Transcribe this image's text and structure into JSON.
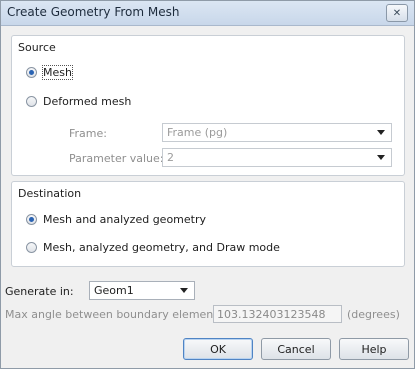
{
  "window": {
    "title": "Create Geometry From Mesh",
    "close_glyph": "✕"
  },
  "source": {
    "label": "Source",
    "options": [
      {
        "label": "Mesh",
        "checked": true
      },
      {
        "label": "Deformed mesh",
        "checked": false
      }
    ],
    "frame": {
      "label": "Frame:",
      "value": "Frame (pg)"
    },
    "parameter": {
      "label": "Parameter value:",
      "value": "2"
    }
  },
  "destination": {
    "label": "Destination",
    "options": [
      {
        "label": "Mesh and analyzed geometry",
        "checked": true
      },
      {
        "label": "Mesh, analyzed geometry, and Draw mode",
        "checked": false
      }
    ]
  },
  "generate_in": {
    "label": "Generate in:",
    "value": "Geom1"
  },
  "max_angle": {
    "label": "Max angle between boundary elements:",
    "value": "103.132403123548",
    "unit": "(degrees)"
  },
  "buttons": {
    "ok": "OK",
    "cancel": "Cancel",
    "help": "Help"
  }
}
